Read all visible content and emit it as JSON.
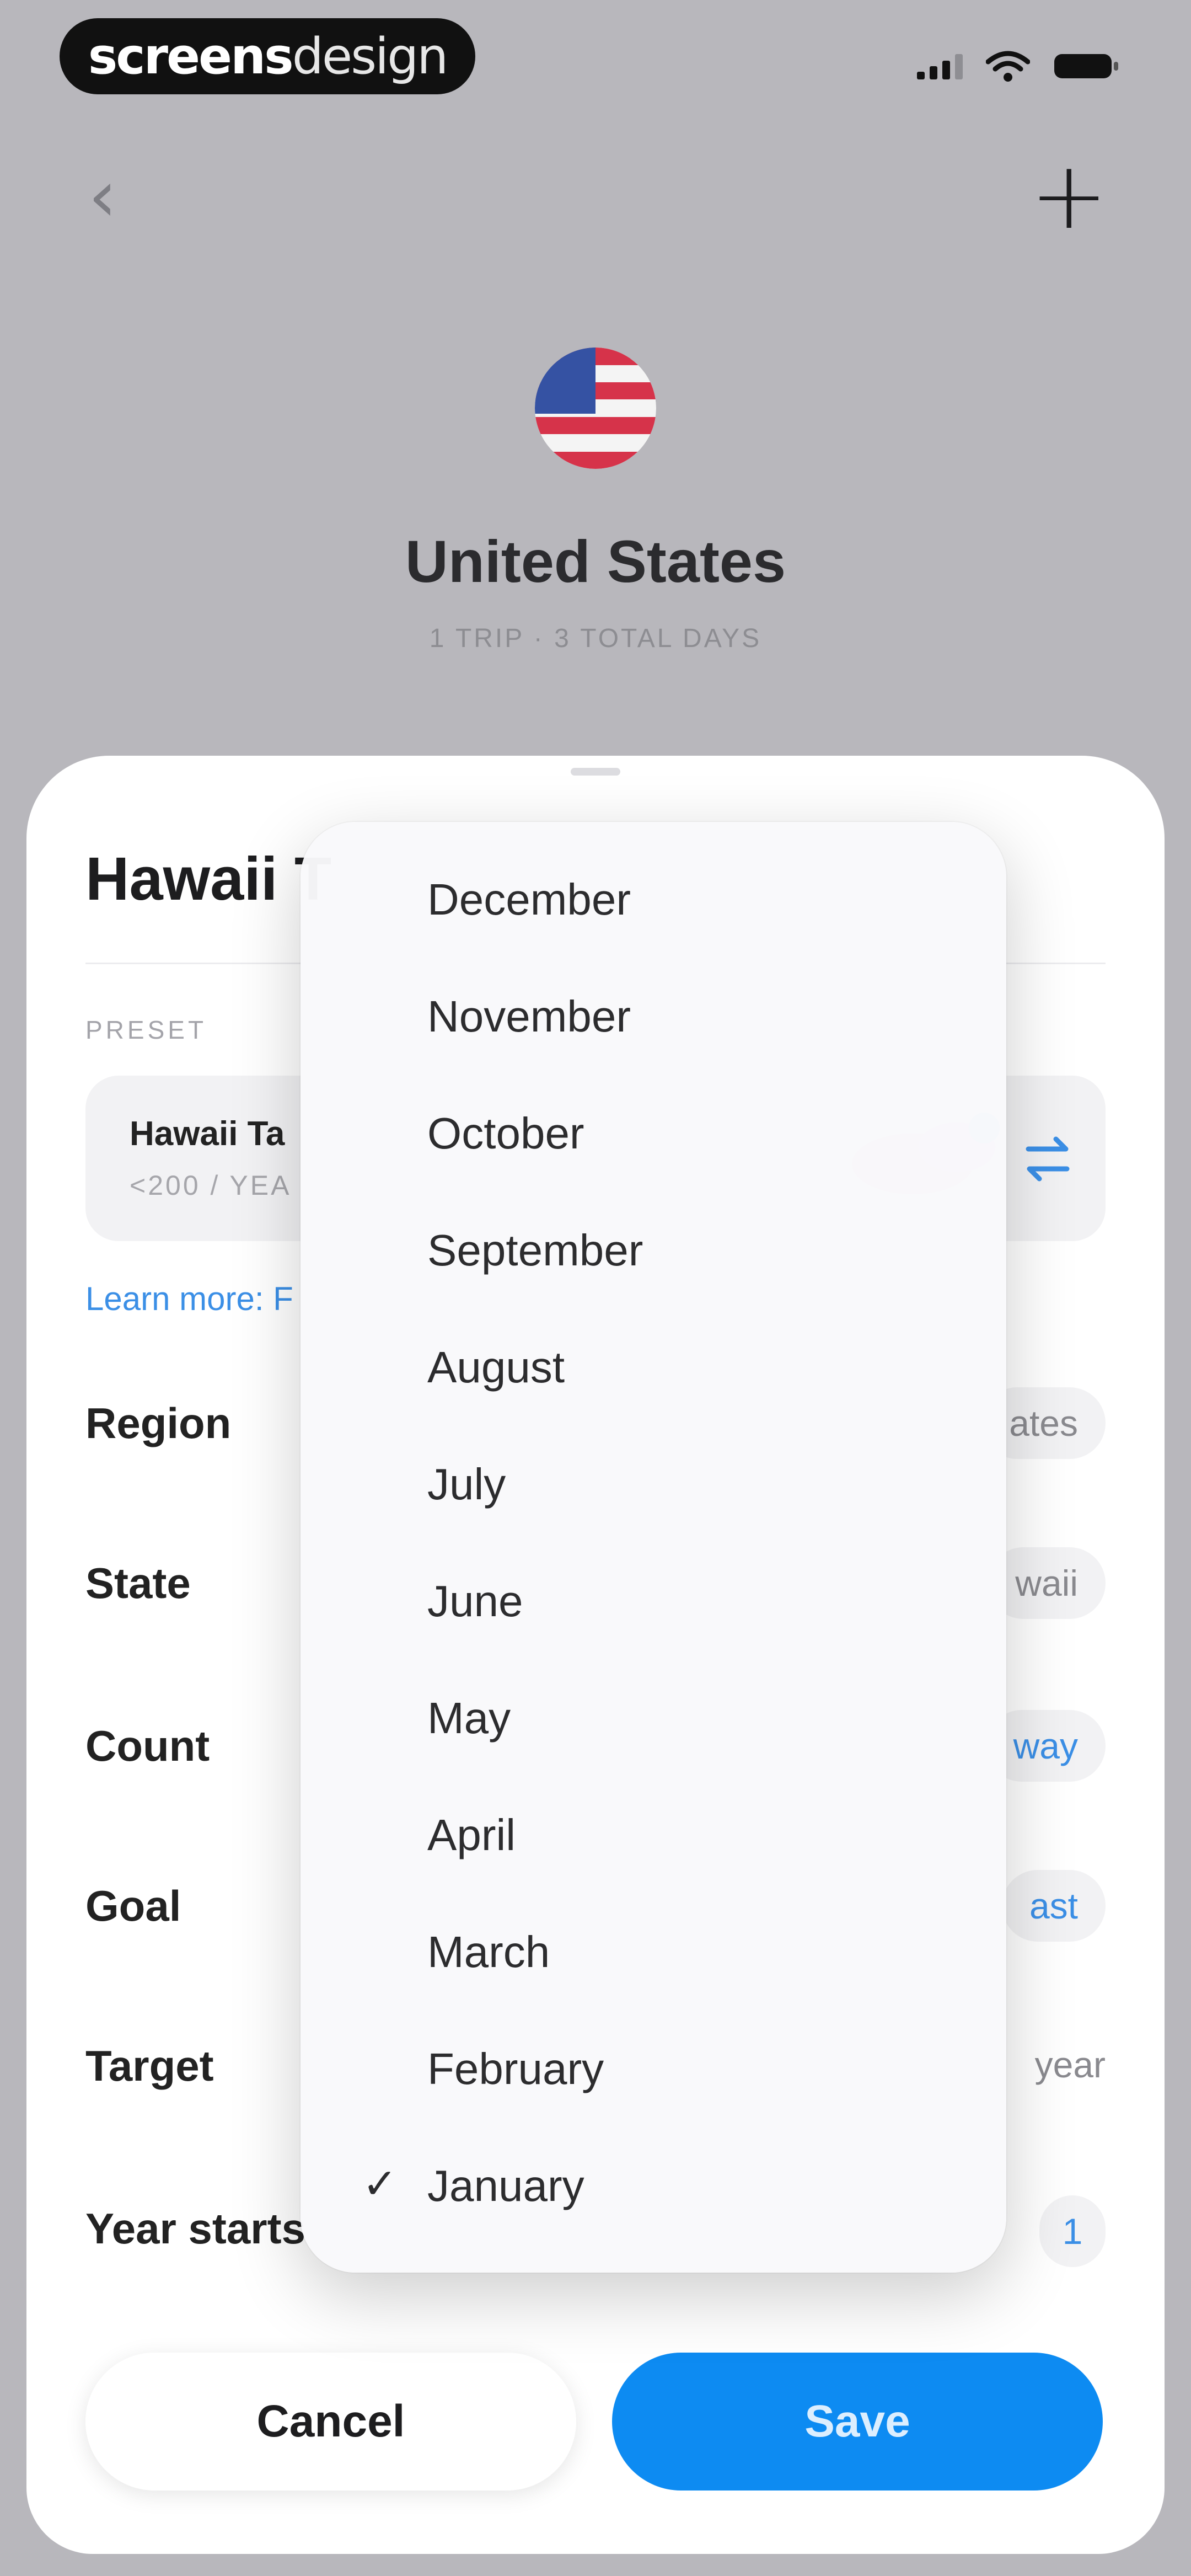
{
  "watermark": {
    "bold": "screens",
    "light": "design"
  },
  "status": {
    "battery_icon": "battery-icon",
    "wifi_icon": "wifi-icon",
    "signal_icon": "signal-icon"
  },
  "header": {
    "back_glyph": "‹",
    "add_glyph": "+",
    "country": "United States",
    "trip_summary": "1 TRIP · 3 TOTAL DAYS"
  },
  "sheet": {
    "title": "Hawaii T",
    "preset_label": "PRESET",
    "preset_name": "Hawaii Ta",
    "preset_sub": "<200 / YEA",
    "learn_more": "Learn more: F",
    "rows": {
      "region": {
        "label": "Region",
        "value": "ates"
      },
      "state": {
        "label": "State",
        "value": "waii"
      },
      "count": {
        "label": "Count",
        "value": "way"
      },
      "goal": {
        "label": "Goal",
        "value": "ast"
      },
      "target": {
        "label": "Target",
        "value": "year"
      },
      "year_starts": {
        "label": "Year starts",
        "value": "1"
      }
    },
    "cancel": "Cancel",
    "save": "Save"
  },
  "month_menu": {
    "items": [
      "December",
      "November",
      "October",
      "September",
      "August",
      "July",
      "June",
      "May",
      "April",
      "March",
      "February",
      "January"
    ],
    "selected": "January",
    "check_glyph": "✓"
  },
  "colors": {
    "accent": "#0d8bf2",
    "link": "#3b8fe6",
    "background": "#b8b7bc"
  }
}
